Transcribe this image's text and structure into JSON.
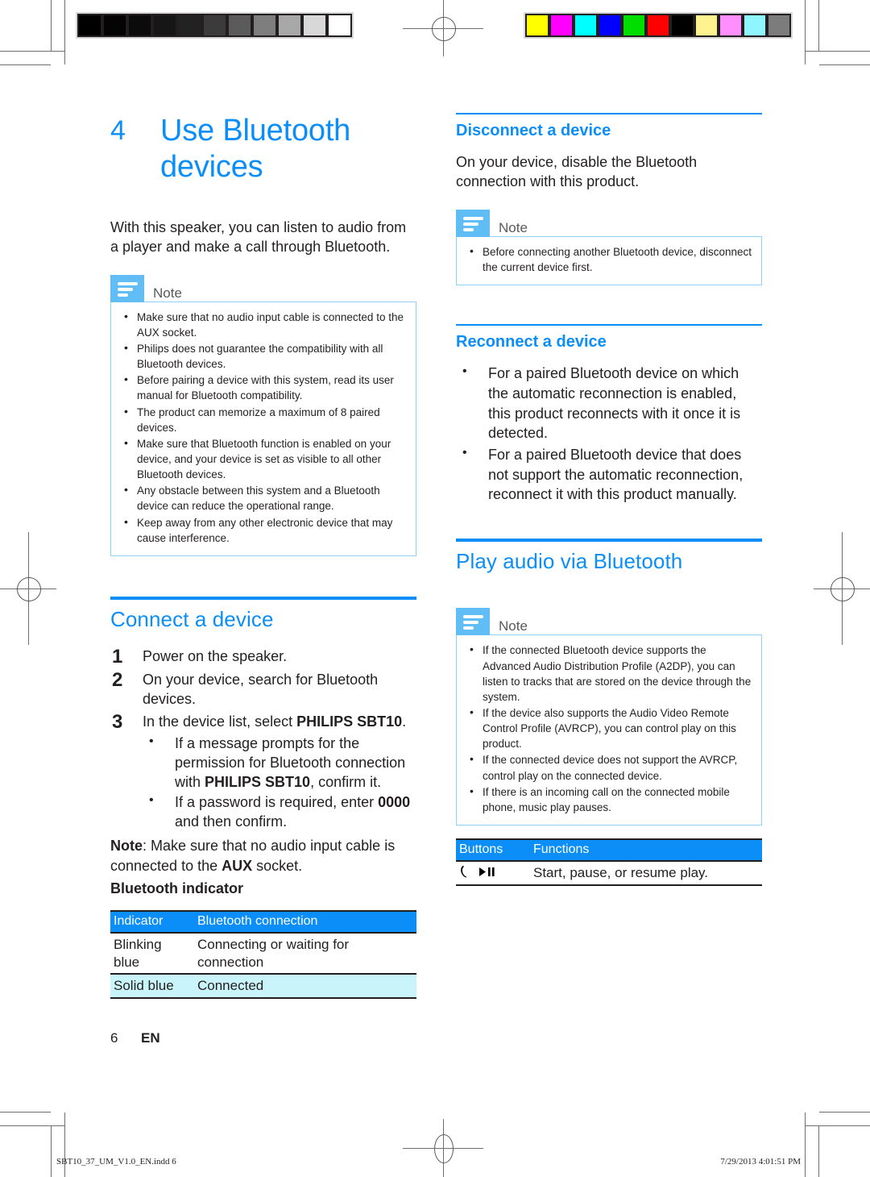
{
  "document": {
    "chapter_number": "4",
    "chapter_title": "Use Bluetooth devices",
    "intro": "With this speaker, you can listen to audio from a player and make a call through Bluetooth.",
    "page_number": "6",
    "language_code": "EN"
  },
  "print_marks": {
    "grayscale_swatches": [
      "#000000",
      "#040404",
      "#0b0b0b",
      "#161616",
      "#222222",
      "#3b3b3b",
      "#5b5b5b",
      "#7e7e7e",
      "#a8a8a8",
      "#d8d8d8",
      "#ffffff"
    ],
    "color_swatches": [
      "#ffff00",
      "#ff00ff",
      "#00ffff",
      "#0000ff",
      "#00dd00",
      "#ff0000",
      "#000000",
      "#fff38f",
      "#ff8fff",
      "#8ff6ff",
      "#7c7c7c"
    ],
    "footer_left": "SBT10_37_UM_V1.0_EN.indd   6",
    "footer_right": "7/29/2013   4:01:51 PM"
  },
  "left_column": {
    "note": {
      "label": "Note",
      "items": [
        "Make sure that no audio input cable is connected to the AUX socket.",
        "Philips does not guarantee the compatibility with all Bluetooth devices.",
        "Before pairing a device with this system, read its user manual for Bluetooth compatibility.",
        "The product can memorize a maximum of 8 paired devices.",
        "Make sure that Bluetooth function is enabled on your device, and your device is set as visible to all other Bluetooth devices.",
        "Any obstacle between this system and a Bluetooth device can reduce the operational range.",
        "Keep away from any other electronic device that may cause interference."
      ]
    },
    "connect": {
      "heading": "Connect a device",
      "step1": "Power on the speaker.",
      "step1_num": "1",
      "step2": "On your device, search for Bluetooth devices.",
      "step2_num": "2",
      "step3_pre": "In the device list, select ",
      "step3_bold": "PHILIPS SBT10",
      "step3_post": ".",
      "step3_num": "3",
      "sub1_a": "If a message prompts for the permission for Bluetooth connection with ",
      "sub1_bold": "PHILIPS SBT10",
      "sub1_b": ", confirm it.",
      "sub2_a": "If a password is required, enter ",
      "sub2_bold": "0000",
      "sub2_b": " and then confirm.",
      "note_label": "Note",
      "note_a": ": Make sure that no audio input cable is connected to the ",
      "note_bold": "AUX",
      "note_b": " socket.",
      "indicator_heading": "Bluetooth indicator"
    },
    "indicator_table": {
      "headers": [
        "Indicator",
        "Bluetooth connection"
      ],
      "rows": [
        [
          "Blinking blue",
          "Connecting or waiting for connection"
        ],
        [
          "Solid blue",
          "Connected"
        ]
      ]
    }
  },
  "right_column": {
    "disconnect": {
      "heading": "Disconnect a device",
      "body": "On your device, disable the Bluetooth connection with this product.",
      "note_label": "Note",
      "note_items": [
        "Before connecting another Bluetooth device, disconnect the current device first."
      ]
    },
    "reconnect": {
      "heading": "Reconnect a device",
      "items": [
        "For a paired Bluetooth device on which the automatic reconnection is enabled, this product reconnects with it once it is detected.",
        "For a paired Bluetooth device that does not support the automatic reconnection, reconnect it with this product manually."
      ]
    },
    "play_audio": {
      "heading": "Play audio via Bluetooth",
      "note_label": "Note",
      "note_items": [
        "If the connected Bluetooth device supports the Advanced Audio Distribution Profile (A2DP), you can listen to tracks that are stored on the device through the system.",
        "If the device also supports the Audio Video Remote Control Profile (AVRCP), you can control play on this product.",
        "If the connected device does not support the AVRCP, control play on the connected device.",
        "If there is an incoming call on the connected mobile phone, music play pauses."
      ]
    },
    "buttons_table": {
      "headers": [
        "Buttons",
        "Functions"
      ],
      "rows": [
        {
          "button_glyph": "☎ ▶❙❙",
          "function": "Start, pause, or resume play."
        }
      ]
    }
  },
  "colors": {
    "philips_blue": "#0b8ef7",
    "note_icon_blue": "#61bdf5",
    "note_border_blue": "#8fd4f5",
    "table_alt_cyan": "#c9f4f9",
    "text_black": "#231f20"
  }
}
